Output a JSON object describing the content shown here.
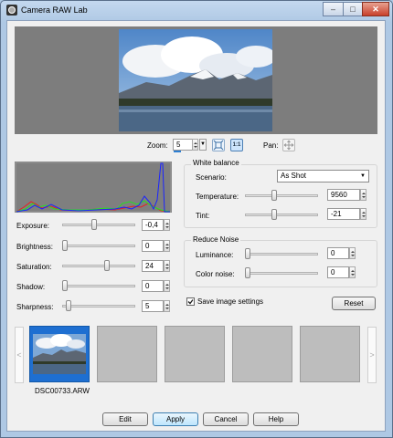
{
  "window": {
    "title": "Camera RAW Lab",
    "caption_buttons": [
      "–",
      "□",
      "✕"
    ]
  },
  "zoom": {
    "label": "Zoom:",
    "value": "5",
    "fit_icon": "fit-to-window-icon",
    "actual_icon": "actual-size-icon",
    "actual_text": "1:1"
  },
  "pan": {
    "label": "Pan:",
    "icon": "pan-move-icon"
  },
  "adjustments": [
    {
      "label": "Exposure:",
      "value": "-0,4",
      "level": 0.45
    },
    {
      "label": "Brightness:",
      "value": "0",
      "level": 0.0
    },
    {
      "label": "Saturation:",
      "value": "24",
      "level": 0.62
    },
    {
      "label": "Shadow:",
      "value": "0",
      "level": 0.0
    },
    {
      "label": "Sharpness:",
      "value": "5",
      "level": 0.05
    }
  ],
  "white_balance": {
    "title": "White balance",
    "scenario_label": "Scenario:",
    "scenario_value": "As Shot",
    "temperature": {
      "label": "Temperature:",
      "value": "9560",
      "level": 0.38
    },
    "tint": {
      "label": "Tint:",
      "value": "-21",
      "level": 0.38
    }
  },
  "reduce_noise": {
    "title": "Reduce Noise",
    "luminance": {
      "label": "Luminance:",
      "value": "0",
      "level": 0.0
    },
    "color_noise": {
      "label": "Color noise:",
      "value": "0",
      "level": 0.0
    }
  },
  "save_settings": {
    "label": "Save image settings",
    "checked": true
  },
  "reset_label": "Reset",
  "filmstrip": {
    "prev": "<",
    "next": ">",
    "files": [
      "DSC00733.ARW",
      "",
      "",
      "",
      ""
    ],
    "selected": 0
  },
  "buttons": {
    "edit": "Edit",
    "apply": "Apply",
    "cancel": "Cancel",
    "help": "Help"
  },
  "colors": {
    "selection": "#1e6fd1",
    "histogram_bg": "#7f7f7f",
    "histogram_blue": "#1a24ff",
    "histogram_green": "#24e024",
    "histogram_red": "#e82020"
  }
}
